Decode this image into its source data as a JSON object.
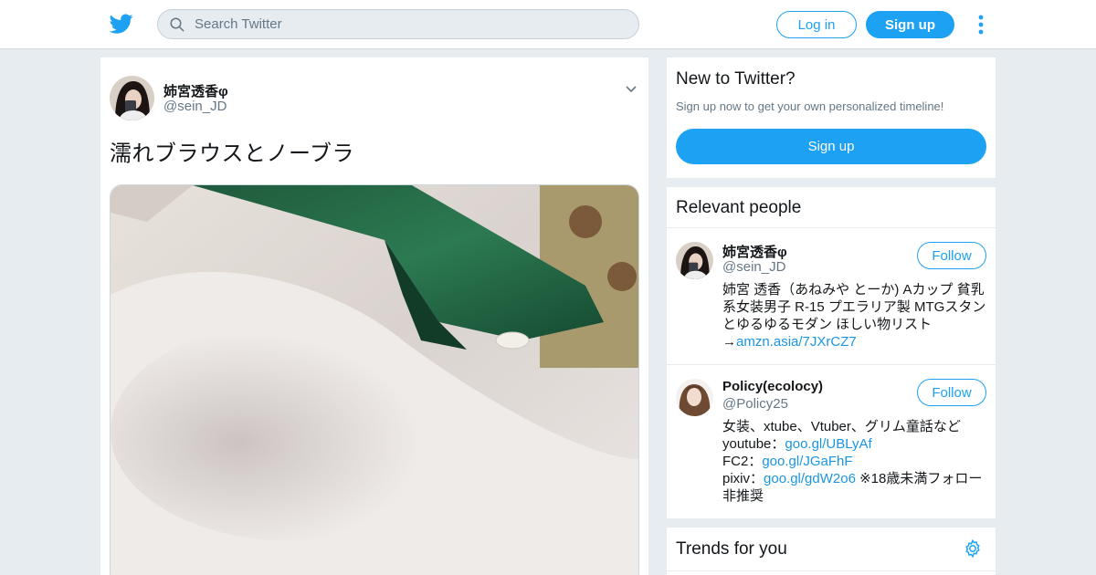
{
  "header": {
    "logo_icon": "twitter-bird-icon",
    "search": {
      "placeholder": "Search Twitter"
    },
    "login_label": "Log in",
    "signup_label": "Sign up",
    "more_icon": "more-vertical-icon",
    "accent_color": "#1da1f2"
  },
  "tweet": {
    "author_name": "姉宮透香φ",
    "author_handle": "@sein_JD",
    "text": "濡れブラウスとノーブラ"
  },
  "sidebar": {
    "new_to_twitter": {
      "title": "New to Twitter?",
      "subtitle": "Sign up now to get your own personalized timeline!",
      "signup_label": "Sign up"
    },
    "relevant_people": {
      "title": "Relevant people",
      "people": [
        {
          "name": "姉宮透香φ",
          "handle": "@sein_JD",
          "follow_label": "Follow",
          "bio_text": "姉宮 透香（あねみや とーか) Aカップ 貧乳系女装男子 R-15 プエラリア製 MTGスタンとゆるゆるモダン ほしい物リスト→",
          "bio_link": "amzn.asia/7JXrCZ7"
        },
        {
          "name": "Policy(ecolocy)",
          "handle": "@Policy25",
          "follow_label": "Follow",
          "bio_line1": "女装、xtube、Vtuber、グリム童話など",
          "bio_yt_label": "youtube：",
          "bio_yt_link": "goo.gl/UBLyAf",
          "bio_fc2_label": "FC2：",
          "bio_fc2_link": "goo.gl/JGaFhF",
          "bio_pixiv_label": "pixiv：",
          "bio_pixiv_link": "goo.gl/gdW2o6",
          "bio_pixiv_note": " ※18歳未満フォロー非推奨"
        }
      ]
    },
    "trends": {
      "title": "Trends for you",
      "settings_icon": "gear-icon"
    }
  }
}
